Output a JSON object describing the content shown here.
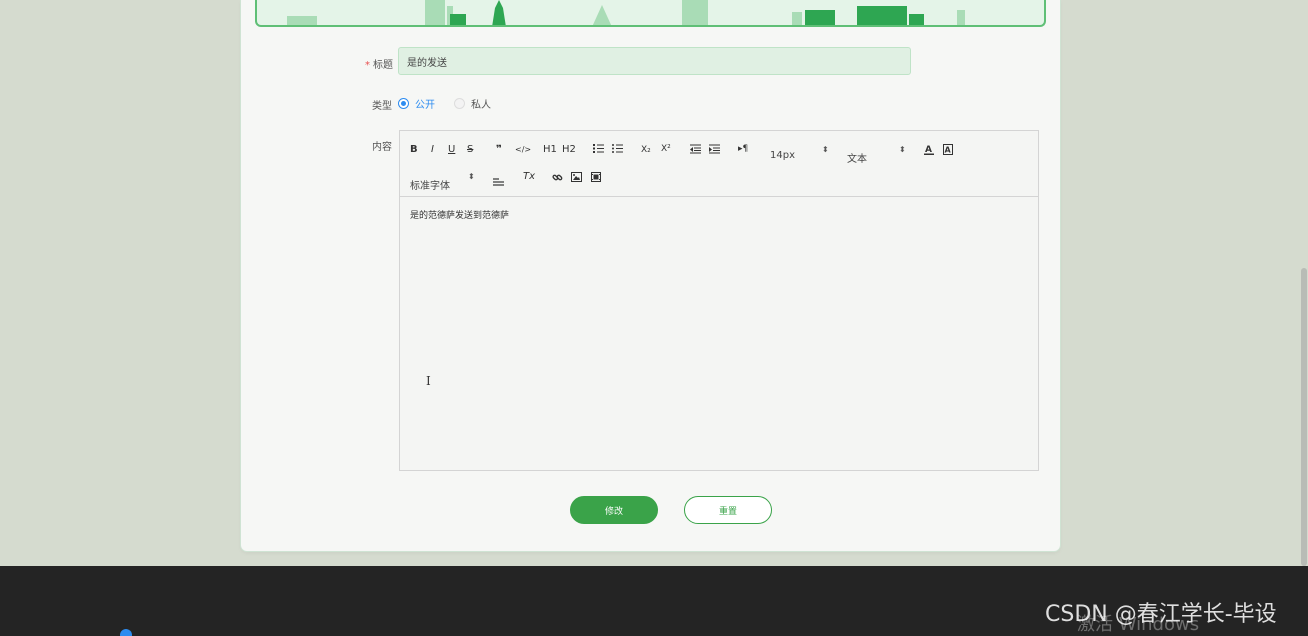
{
  "form": {
    "title_label": "标题",
    "title_value": "是的发送",
    "type_label": "类型",
    "type_options": [
      "公开",
      "私人"
    ],
    "content_label": "内容"
  },
  "toolbar": {
    "bold": "B",
    "italic": "I",
    "underline": "U",
    "strike": "S",
    "quote": "❞",
    "code": "</>",
    "h1": "H1",
    "h2": "H2",
    "subscript": "X₂",
    "superscript": "X²",
    "direction": "▸¶",
    "size_value": "14px",
    "header_value": "文本",
    "font_value": "标准字体",
    "clean": "Tx"
  },
  "editor": {
    "content": "是的范德萨发送到范德萨"
  },
  "buttons": {
    "submit": "修改",
    "reset": "重置"
  },
  "footer": {
    "watermark": "CSDN @春江学长-毕设",
    "activate": "激活 Windows"
  },
  "colors": {
    "primary": "#3aa349",
    "accent_blue": "#2d8cf0",
    "footer_bg": "#242424"
  }
}
